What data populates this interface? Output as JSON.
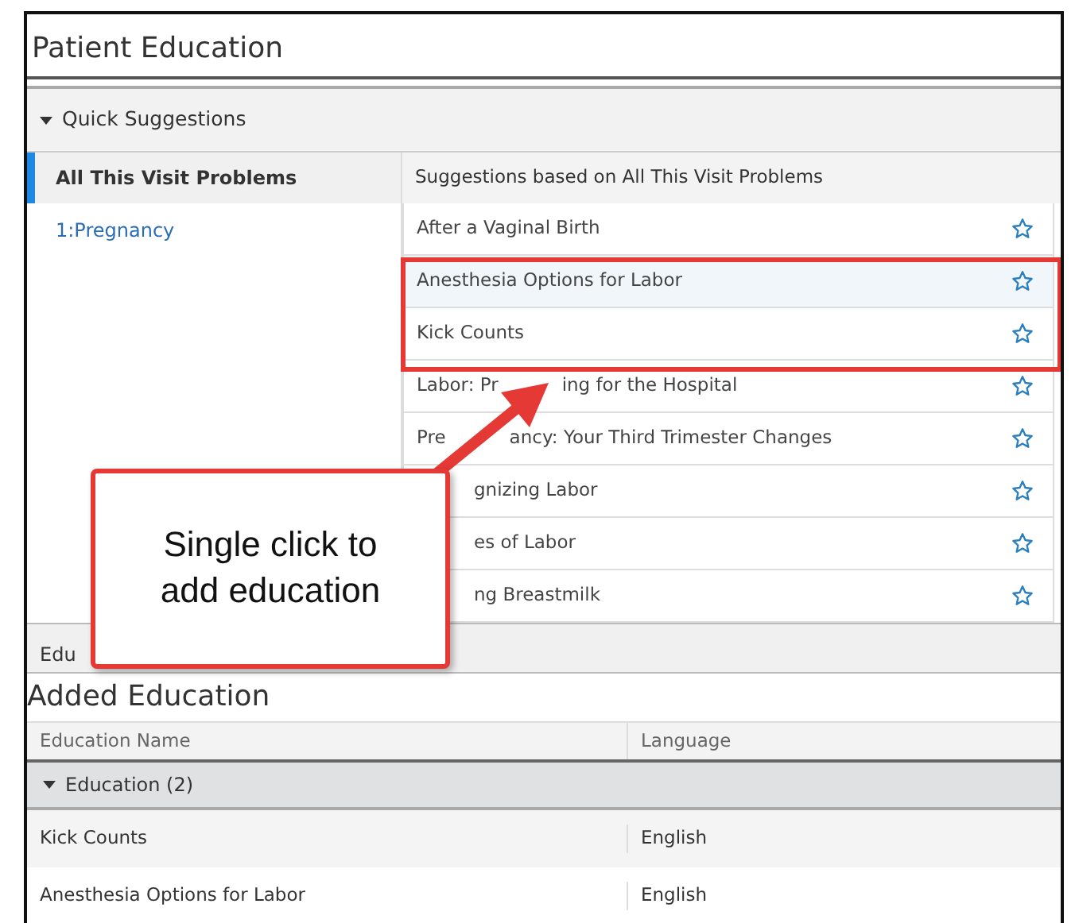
{
  "panel": {
    "title": "Patient Education"
  },
  "quick_suggestions": {
    "label": "Quick Suggestions",
    "expanded": true,
    "problem_filters": [
      {
        "label": "All This Visit Problems",
        "selected": true
      },
      {
        "label": "1:Pregnancy",
        "selected": false
      }
    ],
    "header": "Suggestions based on All This Visit Problems",
    "suggestions": [
      {
        "parts": [
          "After a Vaginal Birth"
        ],
        "highlighted": false,
        "start_covered": false
      },
      {
        "parts": [
          "Anesthesia Options for Labor"
        ],
        "highlighted": true,
        "start_covered": false
      },
      {
        "parts": [
          "Kick Counts"
        ],
        "highlighted": false,
        "start_covered": false
      },
      {
        "parts": [
          "Labor: Pr",
          "ing for the Hospital"
        ],
        "highlighted": false,
        "start_covered": false
      },
      {
        "parts": [
          "Pre",
          "ancy: Your Third Trimester Changes"
        ],
        "highlighted": false,
        "start_covered": false
      },
      {
        "parts": [
          "gnizing Labor"
        ],
        "highlighted": false,
        "start_covered": true
      },
      {
        "parts": [
          "es of Labor"
        ],
        "highlighted": false,
        "start_covered": true
      },
      {
        "parts": [
          "ng Breastmilk"
        ],
        "highlighted": false,
        "start_covered": true
      }
    ]
  },
  "lower_tab": "Edu",
  "added_education": {
    "title": "Added Education",
    "columns": [
      "Education Name",
      "Language"
    ],
    "group": {
      "label": "Education (2)",
      "expanded": true
    },
    "rows": [
      {
        "name": "Kick Counts",
        "language": "English"
      },
      {
        "name": "Anesthesia Options for Labor",
        "language": "English"
      }
    ]
  },
  "callout": {
    "text": "Single click to\nadd education"
  }
}
